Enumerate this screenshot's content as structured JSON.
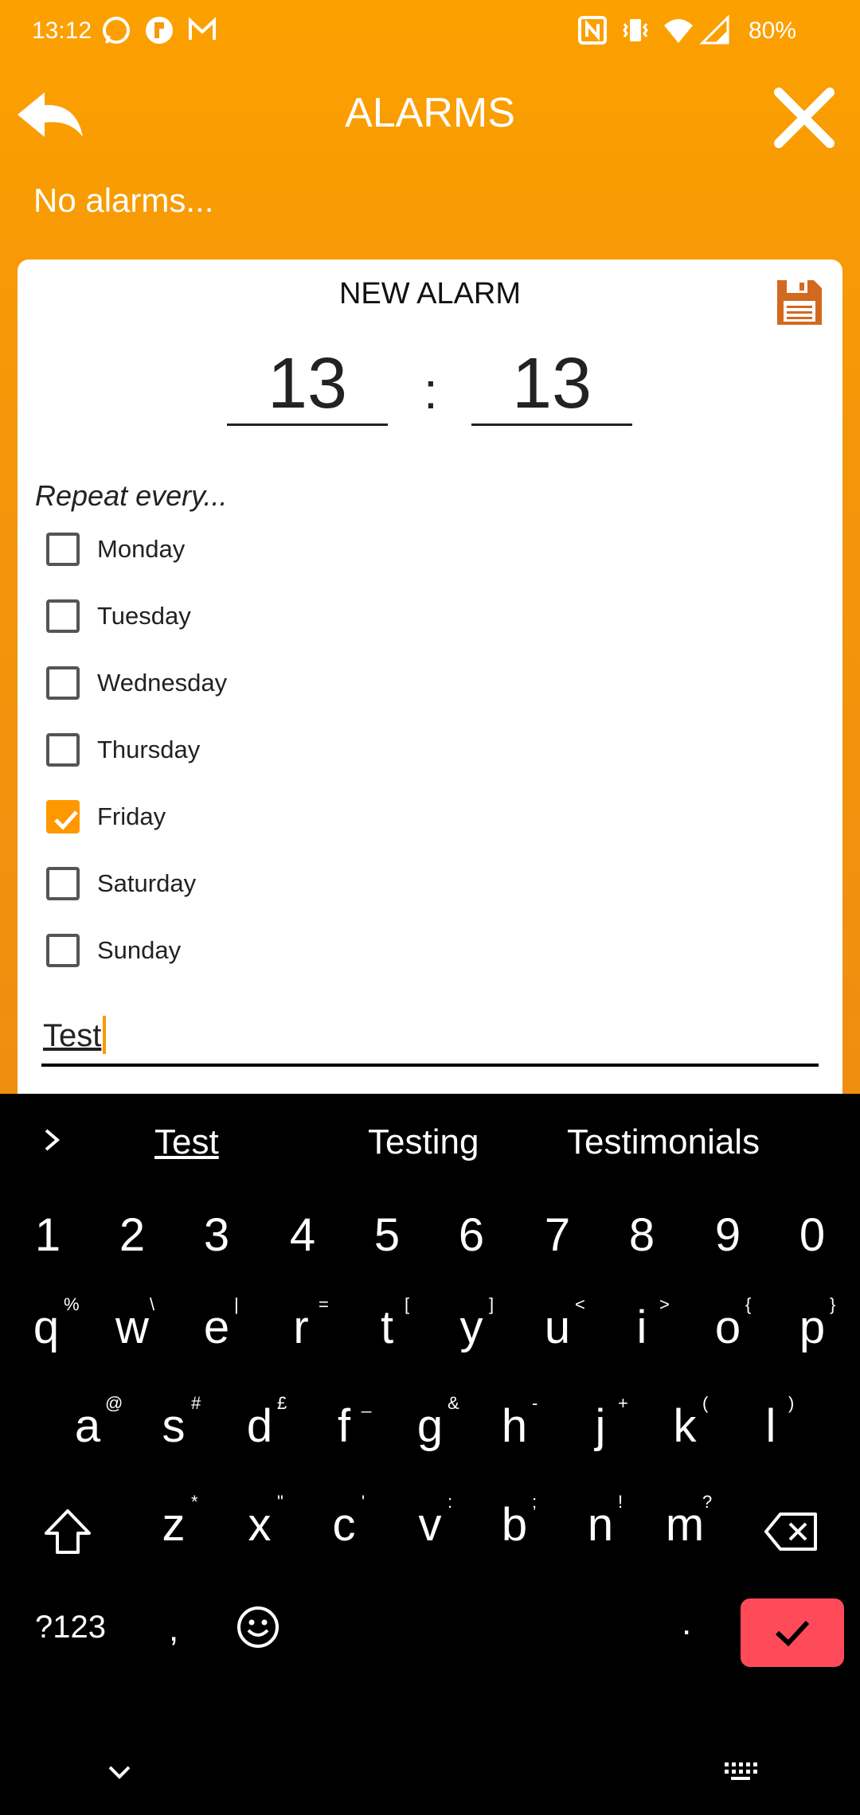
{
  "status": {
    "time": "13:12",
    "battery": "80%"
  },
  "header": {
    "title": "ALARMS"
  },
  "info": {
    "no_alarms": "No alarms..."
  },
  "card": {
    "title": "NEW ALARM",
    "hour": "13",
    "colon": ":",
    "minute": "13",
    "repeat_label": "Repeat every...",
    "days": [
      {
        "label": "Monday",
        "checked": false
      },
      {
        "label": "Tuesday",
        "checked": false
      },
      {
        "label": "Wednesday",
        "checked": false
      },
      {
        "label": "Thursday",
        "checked": false
      },
      {
        "label": "Friday",
        "checked": true
      },
      {
        "label": "Saturday",
        "checked": false
      },
      {
        "label": "Sunday",
        "checked": false
      }
    ],
    "name_value": "Test"
  },
  "keyboard": {
    "suggestions": [
      "Test",
      "Testing",
      "Testimonials"
    ],
    "numbers": [
      "1",
      "2",
      "3",
      "4",
      "5",
      "6",
      "7",
      "8",
      "9",
      "0"
    ],
    "row1": [
      "q",
      "w",
      "e",
      "r",
      "t",
      "y",
      "u",
      "i",
      "o",
      "p"
    ],
    "row1_sup": [
      "%",
      "\\",
      "|",
      "=",
      "[",
      "]",
      "<",
      ">",
      "{",
      "}"
    ],
    "row2": [
      "a",
      "s",
      "d",
      "f",
      "g",
      "h",
      "j",
      "k",
      "l"
    ],
    "row2_sup": [
      "@",
      "#",
      "£",
      "_",
      "&",
      "-",
      "+",
      "(",
      ")"
    ],
    "row3": [
      "z",
      "x",
      "c",
      "v",
      "b",
      "n",
      "m"
    ],
    "row3_sup": [
      "*",
      "\"",
      "'",
      ":",
      ";",
      "!",
      "?"
    ],
    "sym_key": "?123",
    "comma": ",",
    "period": "."
  },
  "colors": {
    "accent": "#ff9800",
    "enter": "#ff4b59"
  }
}
